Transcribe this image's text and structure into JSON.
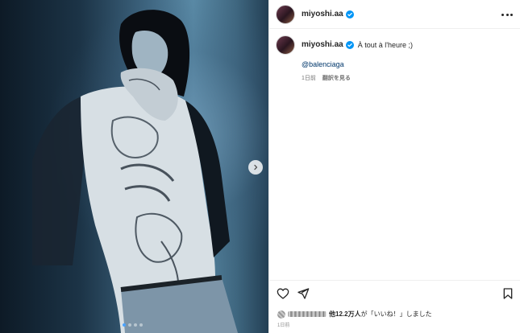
{
  "post": {
    "username": "miyoshi.aa",
    "caption": "À tout à l'heure ;)",
    "mention": "@balenciaga",
    "comment_age": "1日前",
    "translate_label": "翻訳を見る",
    "posted_ago": "1日前"
  },
  "media": {
    "slide_count": 4,
    "active_slide": 1,
    "next_icon": "chevron-right-icon"
  },
  "likes": {
    "count_text": "他12.2万人",
    "particle": "が",
    "suffix": "「いいね！」しました"
  },
  "icons": {
    "verified": "verified-badge-icon",
    "more": "more-options-icon",
    "like": "heart-icon",
    "share": "paper-plane-icon",
    "save": "bookmark-icon"
  },
  "colors": {
    "verified_blue": "#0095f6",
    "mention_link": "#00376b",
    "active_dot": "#4aa3ff"
  }
}
